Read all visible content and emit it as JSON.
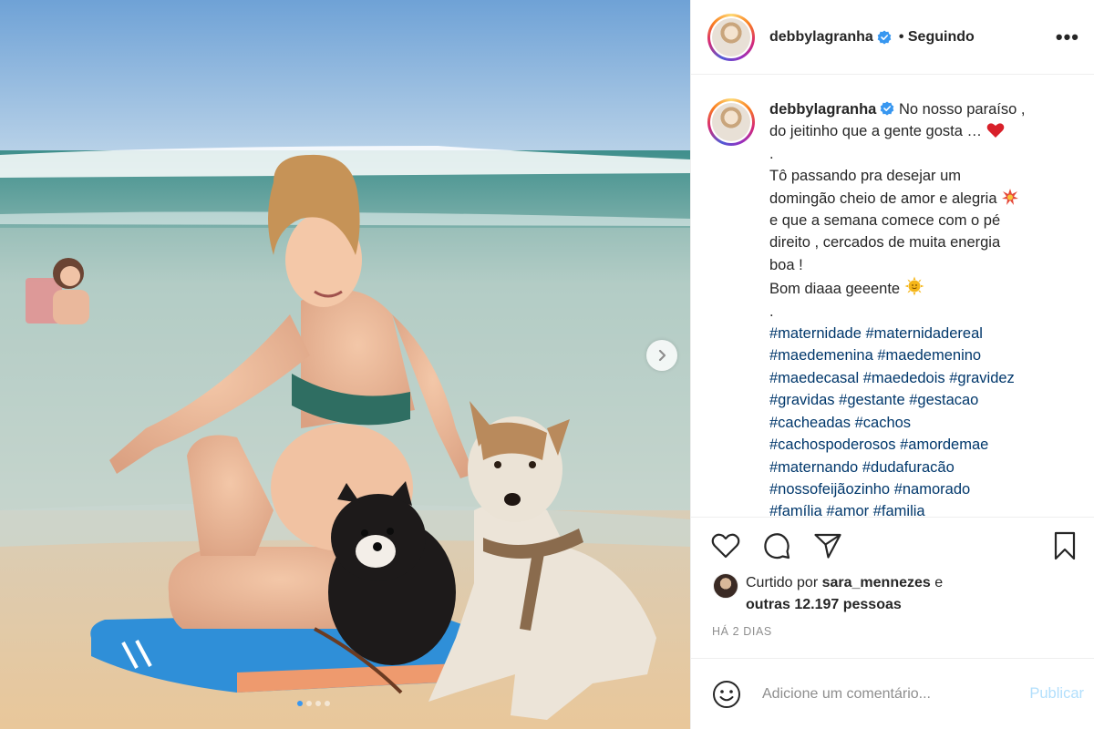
{
  "post": {
    "username": "debbylagranha",
    "separator": "•",
    "follow_status": "Seguindo",
    "more_label": "•••"
  },
  "caption": {
    "username": "debbylagranha",
    "line1": "No nosso paraíso ,",
    "line2": "do jeitinho que a gente gosta …",
    "dot1": ".",
    "body1": "Tô passando pra desejar um",
    "body2": "domingão cheio de amor e alegria",
    "body3": "e que a semana comece com o pé",
    "body4": "direito , cercados de muita energia",
    "body5": "boa !",
    "body6": "Bom diaaa geeente",
    "dot2": ".",
    "hashtags": [
      "#maternidade",
      "#maternidadereal",
      "#maedemenina",
      "#maedemenino",
      "#maedecasal",
      "#maededois",
      "#gravidez",
      "#gravidas",
      "#gestante",
      "#gestacao",
      "#cacheadas",
      "#cachos",
      "#cachospoderosos",
      "#amordemae",
      "#maternando",
      "#dudafuracão",
      "#nossofeijãozinho",
      "#namorado",
      "#família",
      "#amor",
      "#familia"
    ]
  },
  "likes": {
    "prefix": "Curtido por",
    "user": "sara_mennezes",
    "connector": "e",
    "others": "outras 12.197 pessoas"
  },
  "date": "HÁ 2 DIAS",
  "comment": {
    "placeholder": "Adicione um comentário...",
    "publish_label": "Publicar"
  },
  "icons": {
    "like": "heart-icon",
    "comment": "comment-icon",
    "share": "paper-plane-icon",
    "save": "bookmark-icon",
    "emoji": "smiley-icon",
    "verified": "verified-badge-icon",
    "next": "chevron-right-icon"
  },
  "carousel": {
    "count": 4,
    "active_index": 0
  },
  "colors": {
    "verified_blue": "#3897f0",
    "hashtag_blue": "#00376b",
    "publish_disabled": "#b2dffc",
    "muted": "#8e8e8e"
  }
}
